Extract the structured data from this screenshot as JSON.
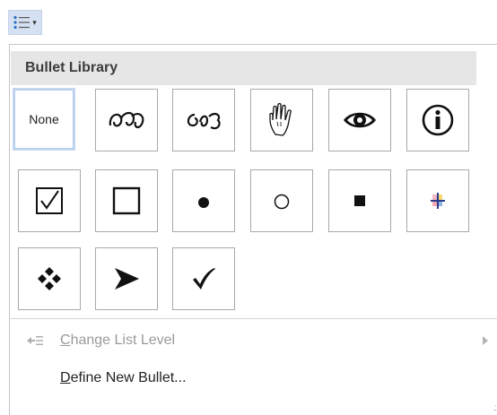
{
  "toolbar": {
    "bullets_button_icon": "bulleted-list-icon",
    "dropdown_arrow": "▾"
  },
  "menu": {
    "section_title": "Bullet Library",
    "tiles": [
      {
        "name": "none",
        "label": "None",
        "selected": true
      },
      {
        "name": "ornate-scroll-1",
        "icon": "ornate-scroll-icon"
      },
      {
        "name": "ornate-scroll-2",
        "icon": "ornate-scroll-icon"
      },
      {
        "name": "hand",
        "icon": "hand-icon"
      },
      {
        "name": "eye",
        "icon": "eye-icon"
      },
      {
        "name": "info",
        "icon": "info-circle-icon"
      },
      {
        "name": "checkbox-checked",
        "icon": "checked-box-icon"
      },
      {
        "name": "hollow-square",
        "icon": "hollow-square-icon"
      },
      {
        "name": "filled-dot",
        "icon": "filled-circle-icon"
      },
      {
        "name": "hollow-circle",
        "icon": "hollow-circle-icon"
      },
      {
        "name": "filled-square",
        "icon": "filled-square-icon"
      },
      {
        "name": "color-cross",
        "icon": "color-cross-icon"
      },
      {
        "name": "four-diamonds",
        "icon": "four-diamonds-icon"
      },
      {
        "name": "arrowhead",
        "icon": "arrowhead-icon"
      },
      {
        "name": "checkmark",
        "icon": "checkmark-icon"
      }
    ],
    "items": {
      "change_level": {
        "prefix": "",
        "mnemonic": "C",
        "rest": "hange List Level",
        "enabled": false
      },
      "define_new": {
        "prefix": "",
        "mnemonic": "D",
        "rest": "efine New Bullet...",
        "enabled": true
      }
    }
  },
  "colors": {
    "accent": "#d5e1f2",
    "header_bg": "#e6e6e6",
    "tile_border": "#a9a9a9",
    "selected_border": "#c5d7ef"
  }
}
